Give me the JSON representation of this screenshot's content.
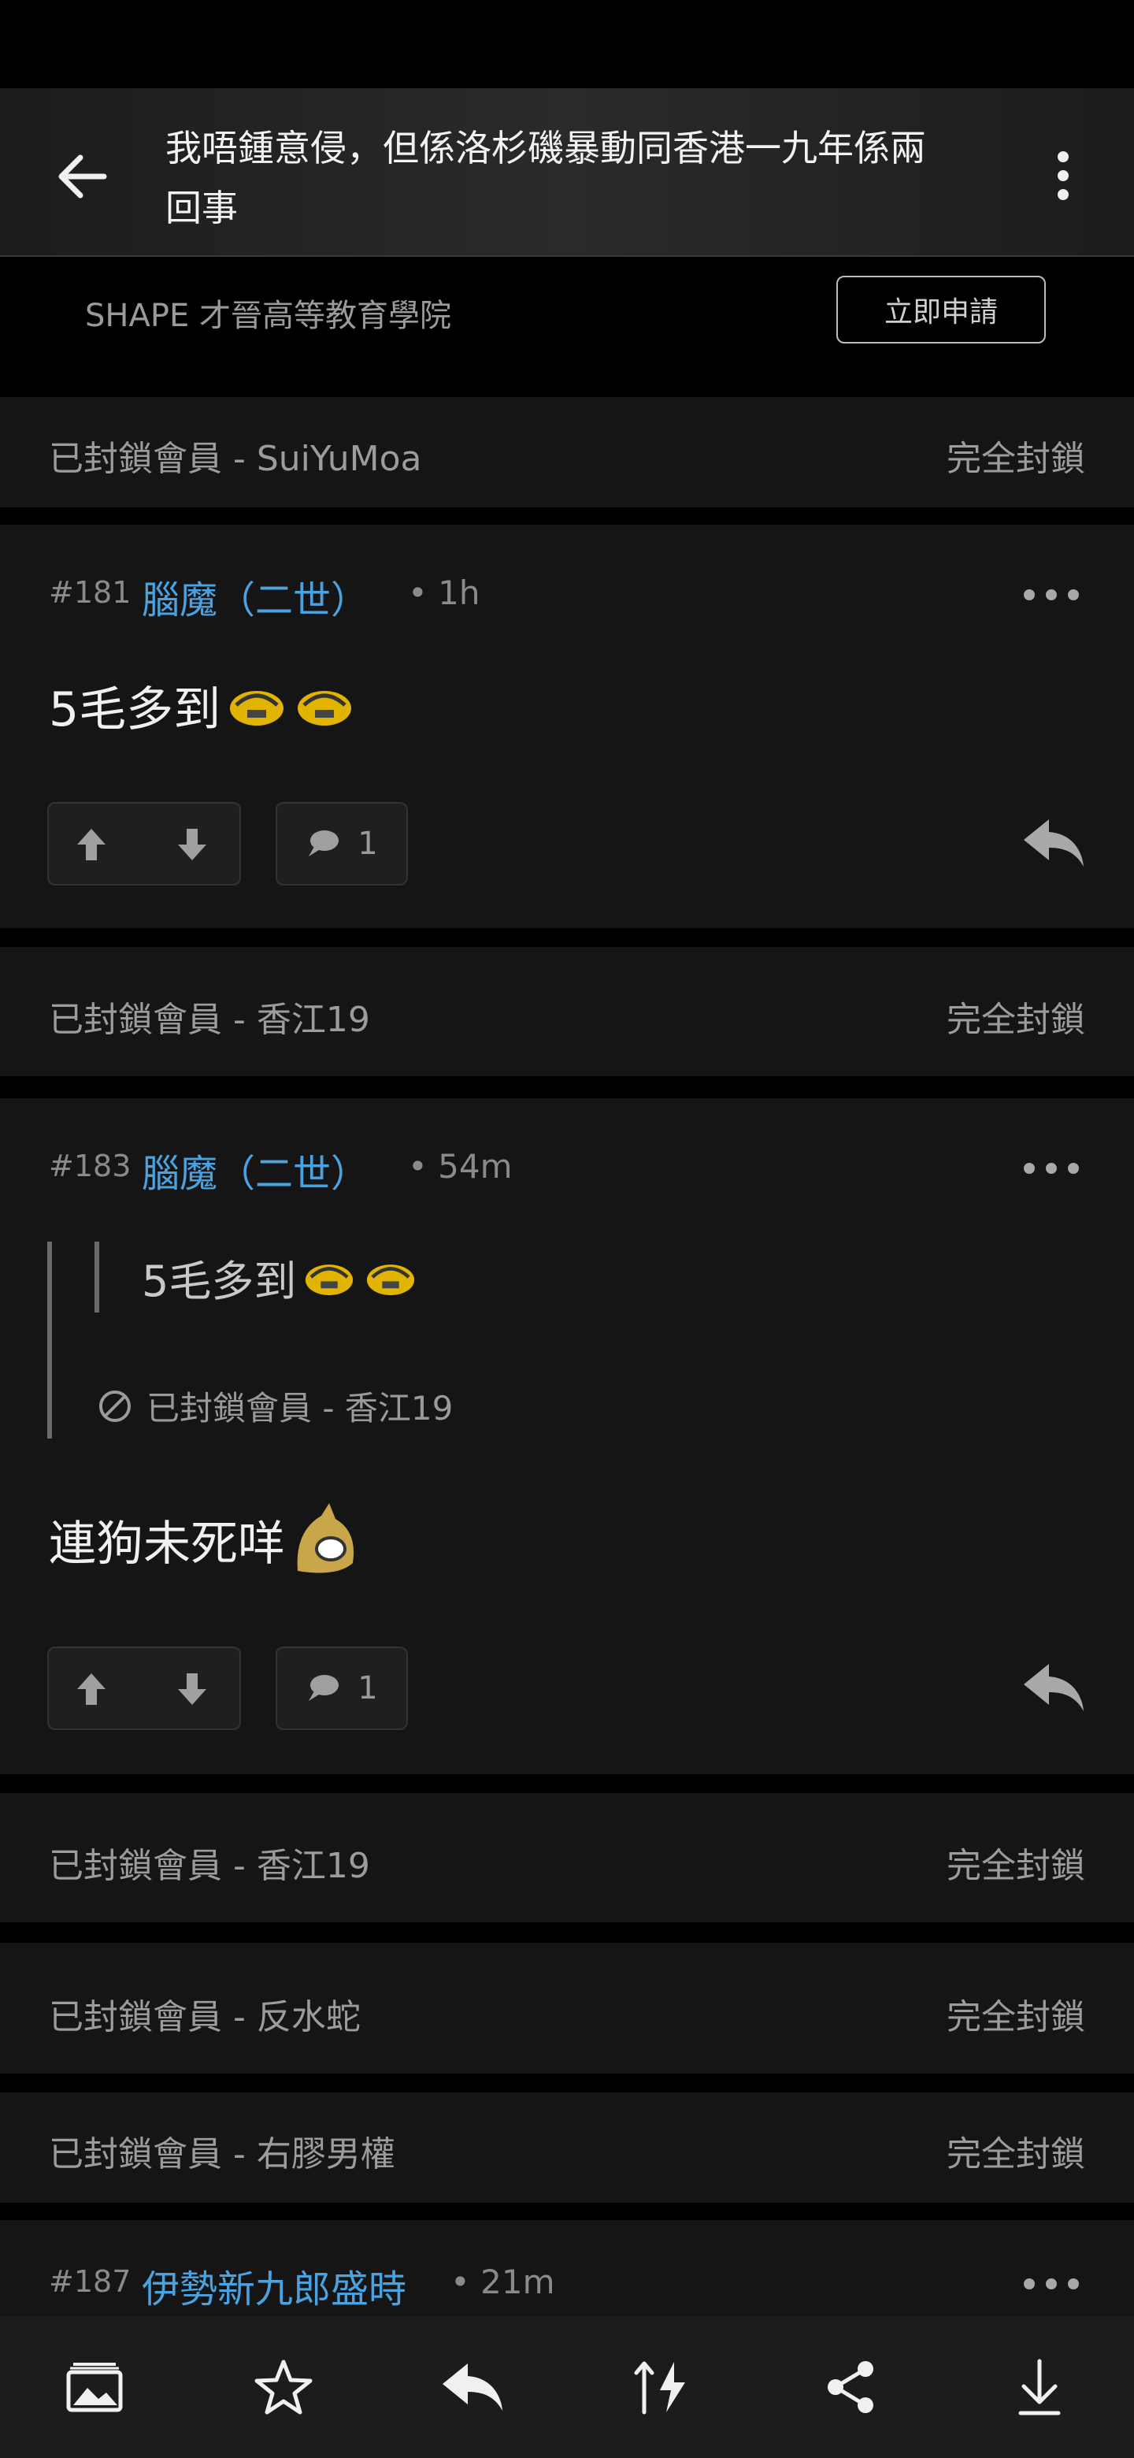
{
  "header": {
    "title": "我唔鍾意侵，但係洛杉磯暴動同香港一九年係兩回事"
  },
  "ad": {
    "text": "SHAPE 才晉高等教育學院",
    "button": "立即申請"
  },
  "blocked_action": "完全封鎖",
  "blocked_rows": [
    {
      "label": "已封鎖會員 - SuiYuMoa"
    },
    {
      "label": "已封鎖會員 - 香江19"
    },
    {
      "label": "已封鎖會員 - 香江19"
    },
    {
      "label": "已封鎖會員 - 反水蛇"
    },
    {
      "label": "已封鎖會員 - 右膠男權"
    }
  ],
  "posts": [
    {
      "number": "#181",
      "author": "腦魔（二世）",
      "time": "• 1h",
      "body": "5毛多到",
      "comments": "1"
    },
    {
      "number": "#183",
      "author": "腦魔（二世）",
      "time": "• 54m",
      "quote_text": "5毛多到",
      "quote_author": "已封鎖會員 - 香江19",
      "body": "連狗未死咩",
      "comments": "1"
    },
    {
      "number": "#187",
      "author": "伊勢新九郎盛時",
      "time": "• 21m"
    }
  ],
  "icons": {
    "accent": "#4aa3e0",
    "bottom": [
      "image-icon",
      "star-icon",
      "reply-icon",
      "sort-icon",
      "share-icon",
      "download-icon"
    ]
  }
}
